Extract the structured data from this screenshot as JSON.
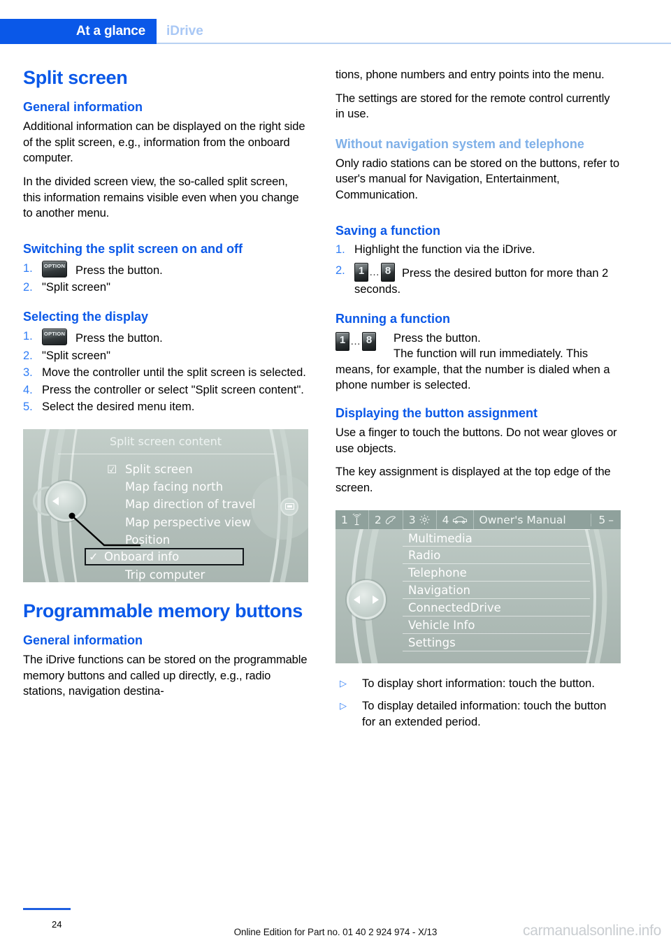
{
  "header": {
    "active_tab": "At a glance",
    "inactive_tab": "iDrive"
  },
  "left_column": {
    "title": "Split screen",
    "general_heading": "General information",
    "general_p1": "Additional information can be displayed on the right side of the split screen, e.g., information from the onboard computer.",
    "general_p2": "In the divided screen view, the so-called split screen, this information remains visible even when you change to another menu.",
    "switching_heading": "Switching the split screen on and off",
    "switching_steps": [
      {
        "num": "1.",
        "text": "Press the button.",
        "icon": "option-button-icon"
      },
      {
        "num": "2.",
        "text": "\"Split screen\""
      }
    ],
    "selecting_heading": "Selecting the display",
    "selecting_steps": [
      {
        "num": "1.",
        "text": "Press the button.",
        "icon": "option-button-icon"
      },
      {
        "num": "2.",
        "text": "\"Split screen\""
      },
      {
        "num": "3.",
        "text": "Move the controller until the split screen is selected."
      },
      {
        "num": "4.",
        "text": "Press the controller or select \"Split screen content\"."
      },
      {
        "num": "5.",
        "text": "Select the desired menu item."
      }
    ],
    "memory_title": "Programmable memory buttons",
    "memory_general_heading": "General information",
    "memory_general_p1": "The iDrive functions can be stored on the programmable memory buttons and called up directly, e.g., radio stations, navigation destina-"
  },
  "screen_a": {
    "title": "Split screen content",
    "items": [
      {
        "label": "Split screen",
        "check": "checkbox-checked-icon"
      },
      {
        "label": "Map facing north",
        "check": ""
      },
      {
        "label": "Map direction of travel",
        "check": ""
      },
      {
        "label": "Map perspective view",
        "check": ""
      },
      {
        "label": "Position",
        "check": ""
      },
      {
        "label": "Trip computer",
        "check": ""
      }
    ],
    "highlighted_item": {
      "label": "Onboard info",
      "check": "checkmark-icon"
    }
  },
  "right_column": {
    "cont_p1": "tions, phone numbers and entry points into the menu.",
    "cont_p2": "The settings are stored for the remote control currently in use.",
    "without_nav_heading": "Without navigation system and telephone",
    "without_nav_p1": "Only radio stations can be stored on the buttons, refer to user's manual for Navigation, Entertainment, Communication.",
    "saving_heading": "Saving a function",
    "saving_steps": [
      {
        "num": "1.",
        "text": "Highlight the function via the iDrive."
      },
      {
        "num": "2.",
        "text": "Press the desired button for more than 2 seconds.",
        "icon_from": "1",
        "icon_to": "8"
      }
    ],
    "running_heading": "Running a function",
    "running_btn_from": "1",
    "running_btn_to": "8",
    "running_line1": "Press the button.",
    "running_line2": "The function will run immediately. This",
    "running_rest": "means, for example, that the number is dialed when a phone number is selected.",
    "displaying_heading": "Displaying the button assignment",
    "displaying_p1": "Use a finger to touch the buttons. Do not wear gloves or use objects.",
    "displaying_p2": "The key assignment is displayed at the top edge of the screen.",
    "arrow_items": [
      "To display short information: touch the button.",
      "To display detailed information: touch the button for an extended period."
    ]
  },
  "screen_b": {
    "topbar": [
      {
        "num": "1",
        "icon": "antenna-icon"
      },
      {
        "num": "2",
        "icon": "phone-handset-icon"
      },
      {
        "num": "3",
        "icon": "gear-icon"
      },
      {
        "num": "4",
        "icon": "car-icon"
      }
    ],
    "topbar_title": "Owner's Manual",
    "topbar_last_num": "5",
    "topbar_last_symbol": "–",
    "items": [
      "Multimedia",
      "Radio",
      "Telephone",
      "Navigation",
      "ConnectedDrive",
      "Vehicle Info",
      "Settings"
    ]
  },
  "footer": {
    "page_number": "24",
    "edition_text": "Online Edition for Part no. 01 40 2 924 974 - X/13",
    "watermark": "carmanualsonline.info"
  },
  "colors": {
    "brand_blue": "#0a58e8",
    "light_blue": "#7fb0e8",
    "step_blue": "#2f7df6",
    "tab_inactive": "#a9c8f5",
    "screen_bg": "#b9c5c1"
  }
}
